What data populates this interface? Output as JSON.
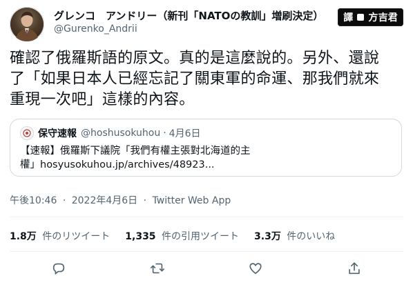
{
  "author": {
    "display_name": "グレンコ　アンドリー（新刊「NATOの教訓」増刷決定）",
    "handle": "@Gurenko_Andrii"
  },
  "badge": {
    "left": "譯",
    "right": "方吉君"
  },
  "tweet": {
    "lines": [
      "確認了俄羅斯語的原文。真的是這麼說的。另外、還說",
      "了「如果日本人已經忘記了關東軍的命運、那我們就來",
      "重現一次吧」這樣的內容。"
    ]
  },
  "quote": {
    "name": "保守速報",
    "handle": "@hoshusokuhou",
    "separator": "·",
    "date": "4月6日",
    "body_line1": "【速報】俄羅斯下議院「我們有權主張對北海道的主",
    "body_line2": "權」hosyusokuhou.jp/archives/48923..."
  },
  "meta": {
    "time": "午後10:46",
    "sep": "·",
    "date": "2022年4月6日",
    "source": "Twitter Web App"
  },
  "stats": {
    "retweets_num": "1.8万",
    "retweets_label": "件のリツイート",
    "quotes_num": "1,335",
    "quotes_label": "件の引用ツイート",
    "likes_num": "3.3万",
    "likes_label": "件のいいね"
  },
  "actions": {
    "icons": [
      "reply-icon",
      "retweet-icon",
      "like-icon",
      "share-icon"
    ]
  },
  "colors": {
    "text_primary": "#0f1419",
    "text_secondary": "#536471",
    "border": "#cfd9de",
    "divider": "#eff3f4"
  }
}
